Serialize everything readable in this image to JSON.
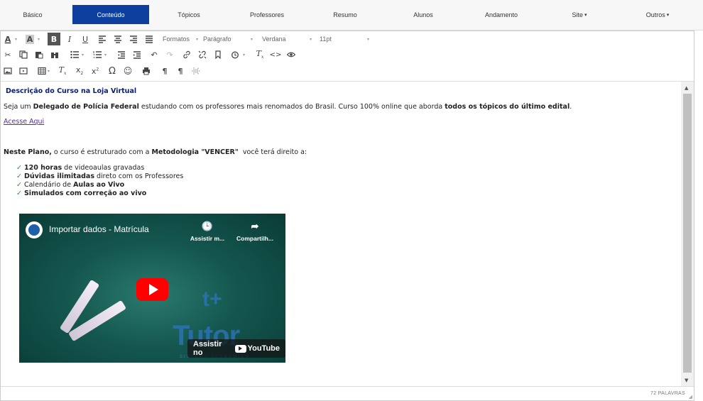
{
  "tabs": [
    {
      "label": "Básico",
      "active": false,
      "dropdown": false
    },
    {
      "label": "Conteúdo",
      "active": true,
      "dropdown": false
    },
    {
      "label": "Tópicos",
      "active": false,
      "dropdown": false
    },
    {
      "label": "Professores",
      "active": false,
      "dropdown": false
    },
    {
      "label": "Resumo",
      "active": false,
      "dropdown": false
    },
    {
      "label": "Alunos",
      "active": false,
      "dropdown": false
    },
    {
      "label": "Andamento",
      "active": false,
      "dropdown": false
    },
    {
      "label": "Site",
      "active": false,
      "dropdown": true
    },
    {
      "label": "Outros",
      "active": false,
      "dropdown": true
    }
  ],
  "toolbar": {
    "formats_label": "Formatos",
    "block_label": "Parágrafo",
    "font_label": "Verdana",
    "size_label": "11pt"
  },
  "content": {
    "heading": "Descrição do Curso na Loja Virtual",
    "p1_a": "Seja um ",
    "p1_b": "Delegado de Polícia Federal",
    "p1_c": " estudando com os professores mais renomados do Brasil. Curso 100% online que aborda ",
    "p1_d": "todos os tópicos do último edital",
    "p1_e": ".",
    "link": "Acesse Aqui",
    "p2_a": "Neste Plano,",
    "p2_b": " o curso é estruturado com a ",
    "p2_c": "Metodologia \"VENCER\"",
    "p2_d": "  você terá direito a:",
    "check": "✓",
    "li1_a": "120 horas",
    "li1_b": " de videoaulas gravadas",
    "li2_a": "Dúvidas ilimitadas",
    "li2_b": " direto com os Professores",
    "li3_a": "Calendário de ",
    "li3_b": "Aulas ao Vivo",
    "li4_a": "Simulados com correção ao vivo"
  },
  "video": {
    "title": "Importar dados - Matrícula",
    "watch_later": "Assistir m...",
    "share": "Compartilh...",
    "watch_on": "Assistir no",
    "youtube": "YouTube",
    "brand": "Tutor",
    "brand_sub": "SISTEMA ACADÊMICO"
  },
  "status": {
    "word_count": "72 PALAVRAS"
  },
  "colors": {
    "active_tab": "#0d3f9f",
    "heading": "#0b1d6b",
    "link": "#5a2ca0",
    "check": "#2e8b2e"
  }
}
